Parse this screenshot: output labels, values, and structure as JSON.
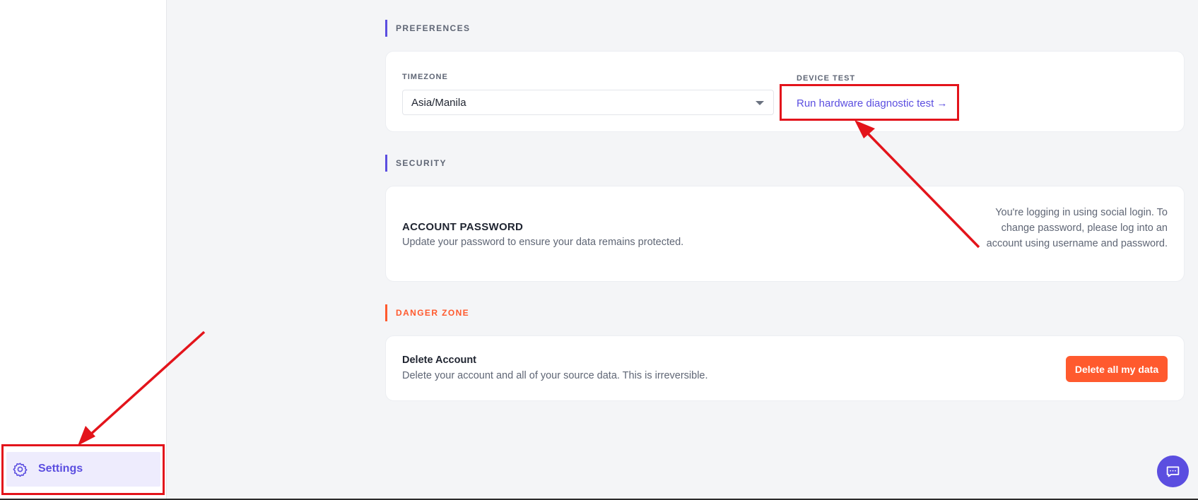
{
  "colors": {
    "accent": "#5b4ee0",
    "danger": "#ff5a2e",
    "annotation": "#e3141b"
  },
  "sidebar": {
    "active_item": {
      "label": "Settings",
      "icon": "gear-icon"
    }
  },
  "preferences": {
    "section_title": "PREFERENCES",
    "timezone": {
      "label": "TIMEZONE",
      "value": "Asia/Manila"
    },
    "device_test": {
      "label": "DEVICE TEST",
      "link_text": "Run hardware diagnostic test →"
    }
  },
  "security": {
    "section_title": "SECURITY",
    "password": {
      "title": "ACCOUNT PASSWORD",
      "description": "Update your password to ensure your data remains protected.",
      "note": "You're logging in using social login. To change password, please log into an account using username and password."
    }
  },
  "danger_zone": {
    "section_title": "DANGER ZONE",
    "delete": {
      "title": "Delete Account",
      "description": "Delete your account and all of your source data. This is irreversible.",
      "button_label": "Delete all my data"
    }
  },
  "chat": {
    "icon": "chat-icon"
  }
}
